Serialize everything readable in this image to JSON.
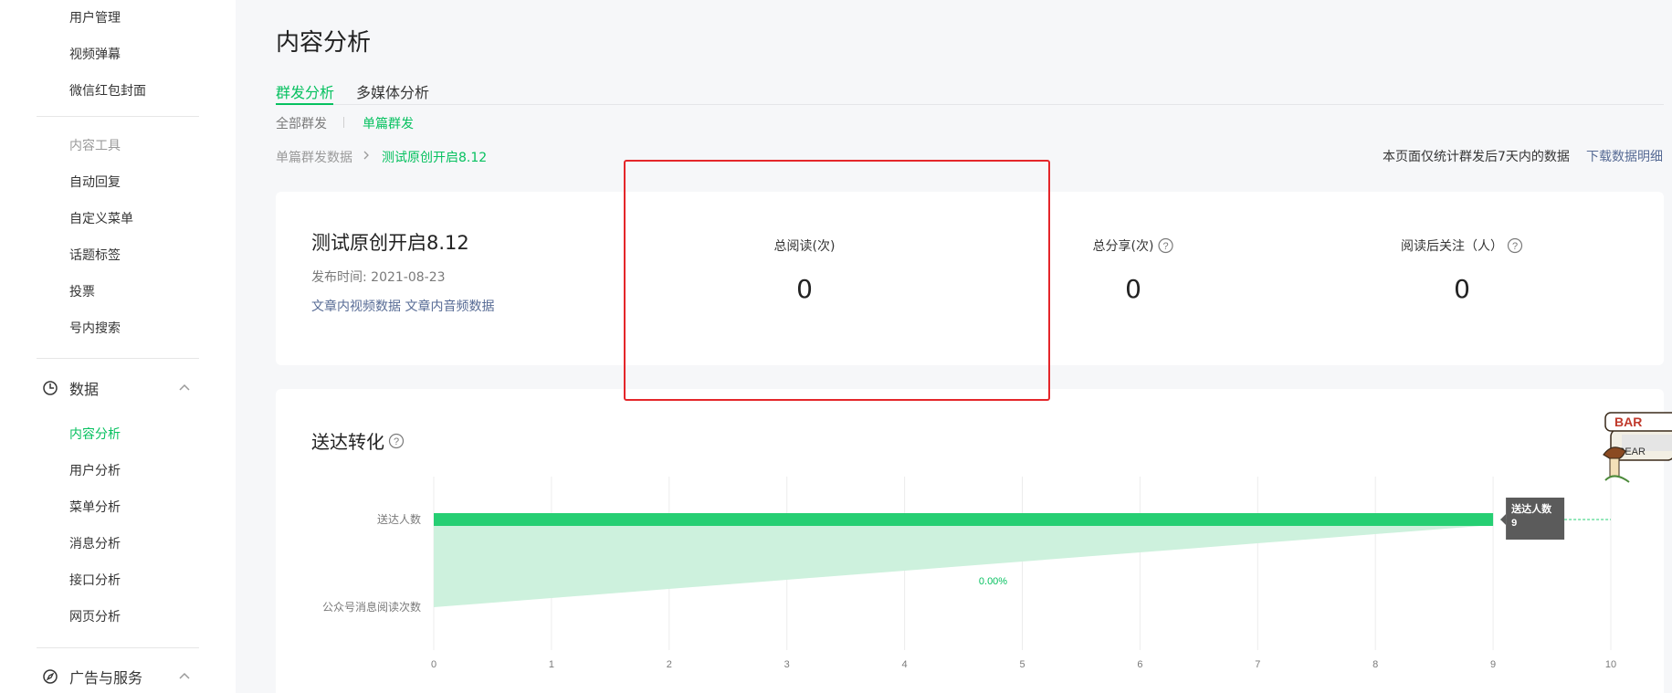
{
  "sidebar": {
    "top_items": [
      "用户管理",
      "视频弹幕",
      "微信红包封面"
    ],
    "tools_header": "内容工具",
    "tools_items": [
      "自动回复",
      "自定义菜单",
      "话题标签",
      "投票",
      "号内搜索"
    ],
    "data_section": "数据",
    "data_items": [
      "内容分析",
      "用户分析",
      "菜单分析",
      "消息分析",
      "接口分析",
      "网页分析"
    ],
    "ads_section": "广告与服务"
  },
  "main": {
    "title": "内容分析",
    "tabs": [
      "群发分析",
      "多媒体分析"
    ],
    "subtabs": [
      "全部群发",
      "单篇群发"
    ],
    "breadcrumb": {
      "parent": "单篇群发数据",
      "current": "测试原创开启8.12"
    },
    "note": "本页面仅统计群发后7天内的数据",
    "download_link": "下载数据明细"
  },
  "article": {
    "title": "测试原创开启8.12",
    "date_label": "发布时间: ",
    "date": "2021-08-23",
    "link_video": "文章内视频数据",
    "link_audio": "文章内音频数据"
  },
  "metrics": [
    {
      "label": "总阅读(次)",
      "value": "0"
    },
    {
      "label": "总分享(次)",
      "value": "0"
    },
    {
      "label": "阅读后关注（人）",
      "value": "0"
    }
  ],
  "funnel": {
    "title": "送达转化",
    "tooltip_name": "送达人数",
    "tooltip_value": "9",
    "conversion_label": "0.00%"
  },
  "chart_data": {
    "type": "bar",
    "orientation": "horizontal",
    "categories": [
      "送达人数",
      "公众号消息阅读次数"
    ],
    "values": [
      9,
      0
    ],
    "xlim": [
      0,
      10
    ],
    "xticks": [
      "0",
      "1",
      "2",
      "3",
      "4",
      "5",
      "6",
      "7",
      "8",
      "9",
      "10"
    ],
    "conversion_rate": "0.00%",
    "grid": true,
    "colors": {
      "bar": "#26cf73",
      "funnel": "#cdf1dd",
      "tooltip": "#5b5b5b"
    }
  },
  "colors": {
    "accent": "#07c160",
    "link": "#576b95",
    "highlight_box": "#e4262a"
  }
}
